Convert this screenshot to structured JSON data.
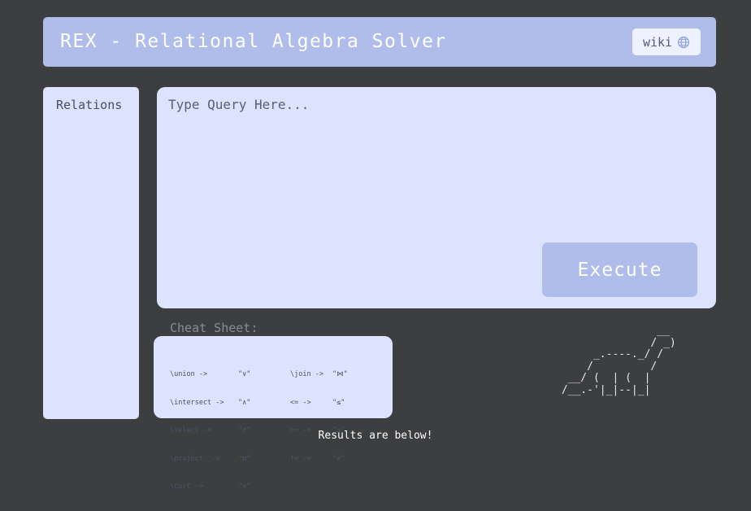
{
  "header": {
    "title": "REX - Relational Algebra Solver",
    "wiki_label": "wiki",
    "wiki_icon": "globe-icon"
  },
  "sidebar": {
    "title": "Relations"
  },
  "query": {
    "placeholder": "Type Query Here...",
    "value": "",
    "execute_label": "Execute"
  },
  "cheat_sheet": {
    "title": "Cheat Sheet:",
    "left": [
      {
        "cmd": "\\union ->",
        "sym": "\"∨\""
      },
      {
        "cmd": "\\intersect ->",
        "sym": "\"∧\""
      },
      {
        "cmd": "\\select ->",
        "sym": "\"σ\""
      },
      {
        "cmd": "\\project_ ->",
        "sym": "\"π\""
      },
      {
        "cmd": "\\cort ->",
        "sym": "\"×\""
      }
    ],
    "right": [
      {
        "cmd": "\\join ->",
        "sym": "\"⋈\""
      },
      {
        "cmd": "<= ->",
        "sym": "\"≤\""
      },
      {
        "cmd": ">= ->",
        "sym": "\"≥\""
      },
      {
        "cmd": "!= ->",
        "sym": "\"≠\""
      }
    ]
  },
  "ascii_art": "                __\n               / _)\n      _.----._/ /\n     /         /\n  __/ (  | (  |\n /__.-'|_|--|_|",
  "footer": {
    "results_text": "Results are below!"
  },
  "colors": {
    "background": "#3d3e40",
    "header": "#b0bcea",
    "panel": "#dde2ff",
    "accent": "#b0bcea"
  }
}
